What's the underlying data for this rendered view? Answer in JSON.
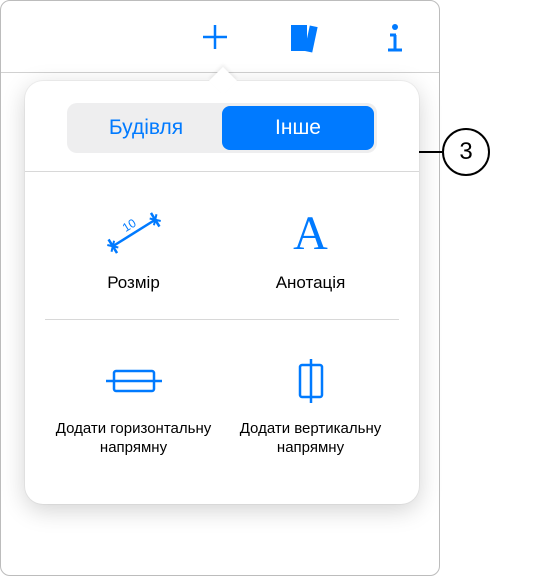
{
  "toolbar": {
    "add_icon": "plus-icon",
    "library_icon": "books-icon",
    "info_icon": "info-icon"
  },
  "popover": {
    "segments": {
      "building": "Будівля",
      "other": "Інше"
    },
    "items": {
      "dimension": {
        "label": "Розмір"
      },
      "annotation": {
        "label": "Анотація",
        "glyph": "A"
      },
      "hguide": {
        "label": "Додати горизонтальну напрямну"
      },
      "vguide": {
        "label": "Додати вертикальну напрямну"
      }
    }
  },
  "callout": {
    "number": "3"
  }
}
